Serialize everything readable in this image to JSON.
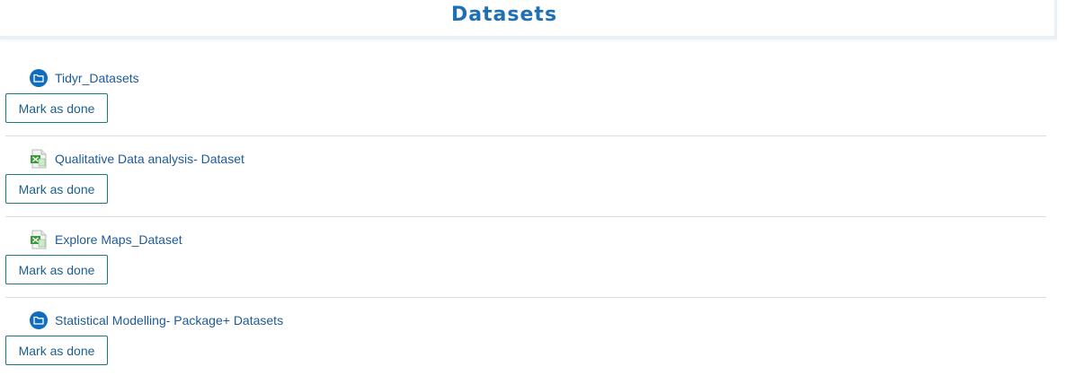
{
  "page": {
    "title": "Datasets"
  },
  "activities": [
    {
      "name": "Tidyr_Datasets",
      "icon": "folder-icon",
      "button_label": "Mark as done"
    },
    {
      "name": "Qualitative Data analysis- Dataset",
      "icon": "spreadsheet-icon",
      "button_label": "Mark as done"
    },
    {
      "name": "Explore Maps_Dataset",
      "icon": "spreadsheet-icon",
      "button_label": "Mark as done"
    },
    {
      "name": "Statistical Modelling- Package+ Datasets",
      "icon": "folder-icon",
      "button_label": "Mark as done"
    }
  ],
  "colors": {
    "accent": "#1f6fb5",
    "link": "#1e5a96",
    "button_border": "#1b7a7e",
    "folder_icon": "#0f6cbf",
    "spreadsheet_icon": "#3a9a3a"
  }
}
